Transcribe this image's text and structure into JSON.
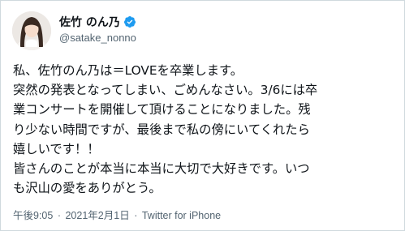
{
  "user": {
    "display_name": "佐竹 のん乃",
    "handle": "@satake_nonno",
    "verified": true,
    "avatar_icon": "profile-photo-avatar",
    "verified_icon": "verified-badge-icon"
  },
  "tweet": {
    "lines": [
      "私、佐竹のん乃は＝LOVEを卒業します。",
      "突然の発表となってしまい、ごめんなさい。3/6には卒",
      "業コンサートを開催して頂けることになりました。残",
      "り少ない時間ですが、最後まで私の傍にいてくれたら",
      "嬉しいです！！",
      "皆さんのことが本当に本当に大切で大好きです。いつ",
      "も沢山の愛をありがとう。"
    ]
  },
  "meta": {
    "time": "午後9:05",
    "separator": "·",
    "date": "2021年2月1日",
    "source": "Twitter for iPhone"
  },
  "colors": {
    "text": "#0f1419",
    "secondary": "#536471",
    "verified": "#1d9bf0",
    "border": "#cfd9de"
  }
}
